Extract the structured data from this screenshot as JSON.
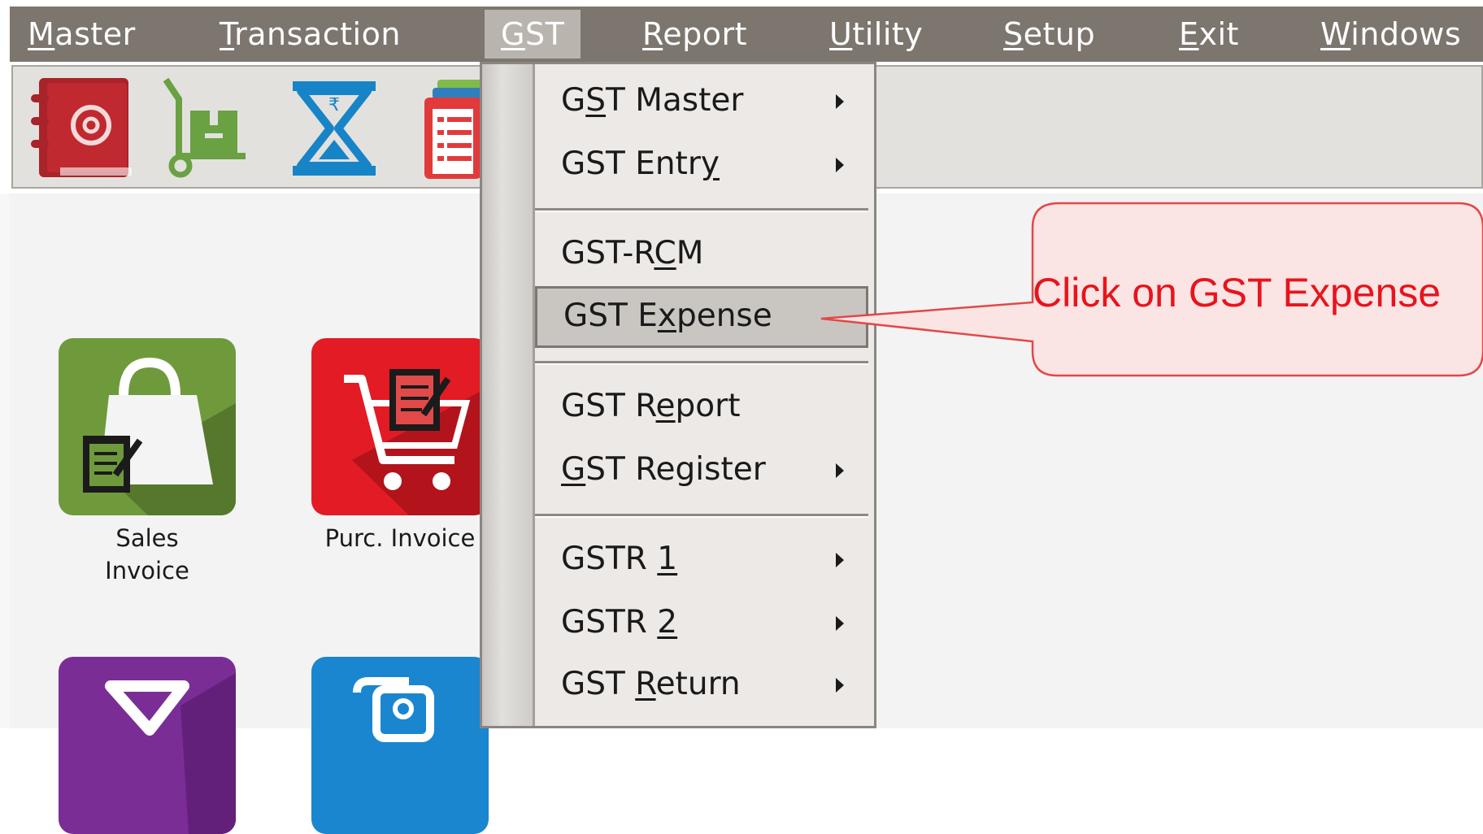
{
  "menubar": {
    "items": [
      {
        "label": "Master",
        "accel": "M",
        "rest": "aster"
      },
      {
        "label": "Transaction",
        "accel": "T",
        "rest": "ransaction"
      },
      {
        "label": "GST",
        "accel": "G",
        "rest": "ST"
      },
      {
        "label": "Report",
        "accel": "R",
        "rest": "eport"
      },
      {
        "label": "Utility",
        "accel": "U",
        "rest": "tility"
      },
      {
        "label": "Setup",
        "accel": "S",
        "rest": "etup"
      },
      {
        "label": "Exit",
        "accel": "E",
        "rest": "xit"
      },
      {
        "label": "Windows",
        "accel": "W",
        "rest": "indows"
      }
    ],
    "active": "GST"
  },
  "gst_menu": {
    "items": [
      {
        "pre": "G",
        "accel": "S",
        "post": "T Master",
        "label": "GST Master",
        "submenu": true
      },
      {
        "pre": "GST Entr",
        "accel": "y",
        "post": "",
        "label": "GST Entry",
        "submenu": true
      },
      {
        "pre": "GST-R",
        "accel": "C",
        "post": "M",
        "label": "GST-RCM",
        "submenu": false
      },
      {
        "pre": "GST E",
        "accel": "x",
        "post": "pense",
        "label": "GST Expense",
        "submenu": false,
        "highlighted": true
      },
      {
        "pre": "GST R",
        "accel": "e",
        "post": "port",
        "label": "GST Report",
        "submenu": false
      },
      {
        "pre": "",
        "accel": "G",
        "post": "ST Register",
        "label": "GST Register",
        "submenu": true
      },
      {
        "pre": "GSTR ",
        "accel": "1",
        "post": "",
        "label": "GSTR 1",
        "submenu": true
      },
      {
        "pre": "GSTR ",
        "accel": "2",
        "post": "",
        "label": "GSTR 2",
        "submenu": true
      },
      {
        "pre": "GST ",
        "accel": "R",
        "post": "eturn",
        "label": "GST Return",
        "submenu": true
      }
    ]
  },
  "toolbar": {
    "icons": [
      "address-book-icon",
      "hand-truck-icon",
      "hourglass-icon",
      "notepad-icon"
    ]
  },
  "tiles": [
    {
      "name": "sales-invoice",
      "label_line1": "Sales",
      "label_line2": "Invoice",
      "color": "#6e9a3c"
    },
    {
      "name": "purc-invoice",
      "label_line1": "Purc. Invoice",
      "label_line2": "",
      "color": "#e21b24"
    },
    {
      "name": "purple-tile",
      "label_line1": "",
      "label_line2": "",
      "color": "#7b2d96"
    },
    {
      "name": "blue-tile",
      "label_line1": "",
      "label_line2": "",
      "color": "#1a86cf"
    }
  ],
  "callout": {
    "text": "Click on GST Expense",
    "color": "#e8141c"
  }
}
